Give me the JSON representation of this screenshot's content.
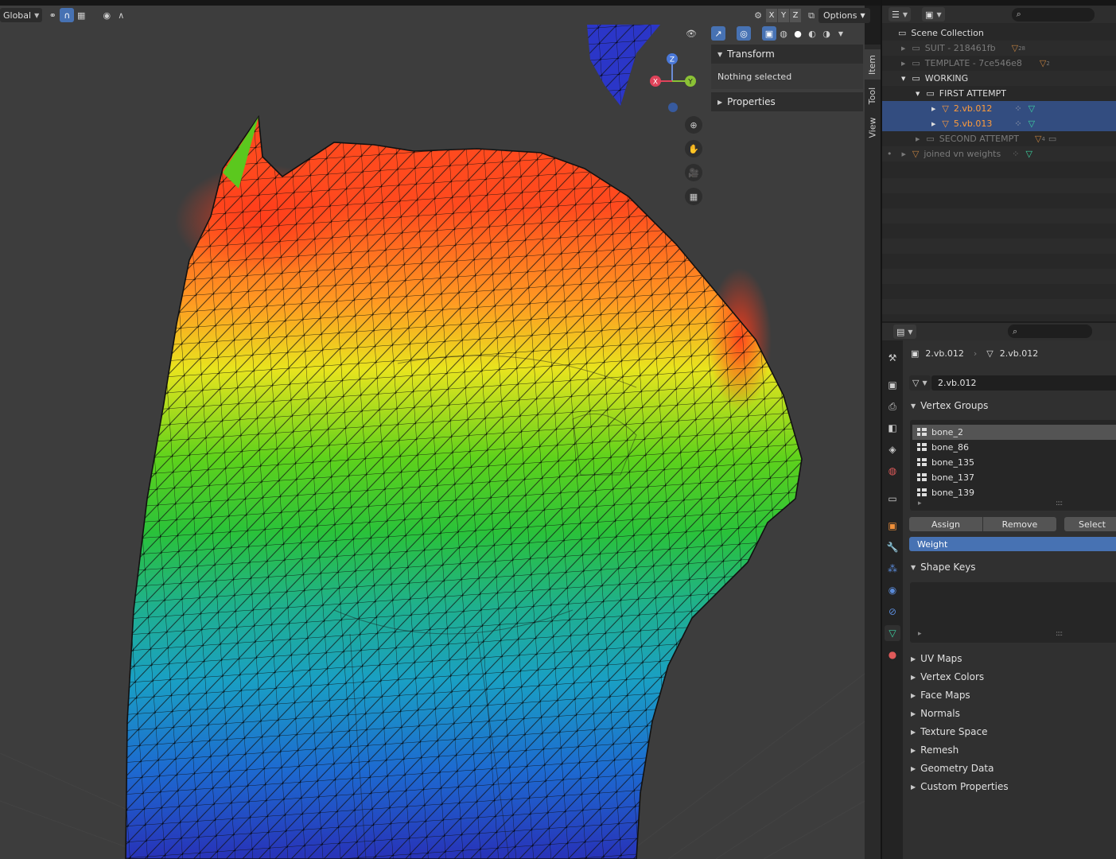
{
  "header": {
    "orientation": "Global",
    "axes": [
      "X",
      "Y",
      "Z"
    ],
    "options_label": "Options"
  },
  "npanel": {
    "transform_label": "Transform",
    "nothing_selected": "Nothing selected",
    "properties_label": "Properties",
    "tabs": [
      "Item",
      "Tool",
      "View"
    ]
  },
  "gizmo": {
    "x": "X",
    "y": "Y",
    "z": "Z"
  },
  "outliner": {
    "rows": [
      {
        "label": "Scene Collection",
        "count": ""
      },
      {
        "label": "SUIT - 218461fb",
        "count": "28"
      },
      {
        "label": "TEMPLATE - 7ce546e8",
        "count": "2"
      },
      {
        "label": "WORKING",
        "count": ""
      },
      {
        "label": "FIRST ATTEMPT",
        "count": ""
      },
      {
        "label": "2.vb.012",
        "count": ""
      },
      {
        "label": "5.vb.013",
        "count": ""
      },
      {
        "label": "SECOND ATTEMPT",
        "count": "4"
      },
      {
        "label": "joined vn weights",
        "count": ""
      }
    ]
  },
  "properties": {
    "object_name": "2.vb.012",
    "mesh_name": "2.vb.012",
    "datablock_name": "2.vb.012",
    "vertex_groups_label": "Vertex Groups",
    "vertex_groups": [
      "bone_2",
      "bone_86",
      "bone_135",
      "bone_137",
      "bone_139"
    ],
    "assign_label": "Assign",
    "remove_label": "Remove",
    "select_label": "Select",
    "weight_label": "Weight",
    "shape_keys_label": "Shape Keys",
    "sections": [
      "UV Maps",
      "Vertex Colors",
      "Face Maps",
      "Normals",
      "Texture Space",
      "Remesh",
      "Geometry Data",
      "Custom Properties"
    ]
  },
  "colors": {
    "selection": "#334d80",
    "accent": "#4772b3",
    "active_text": "#ff9c3b",
    "viewport_bg": "#3d3d3d"
  }
}
